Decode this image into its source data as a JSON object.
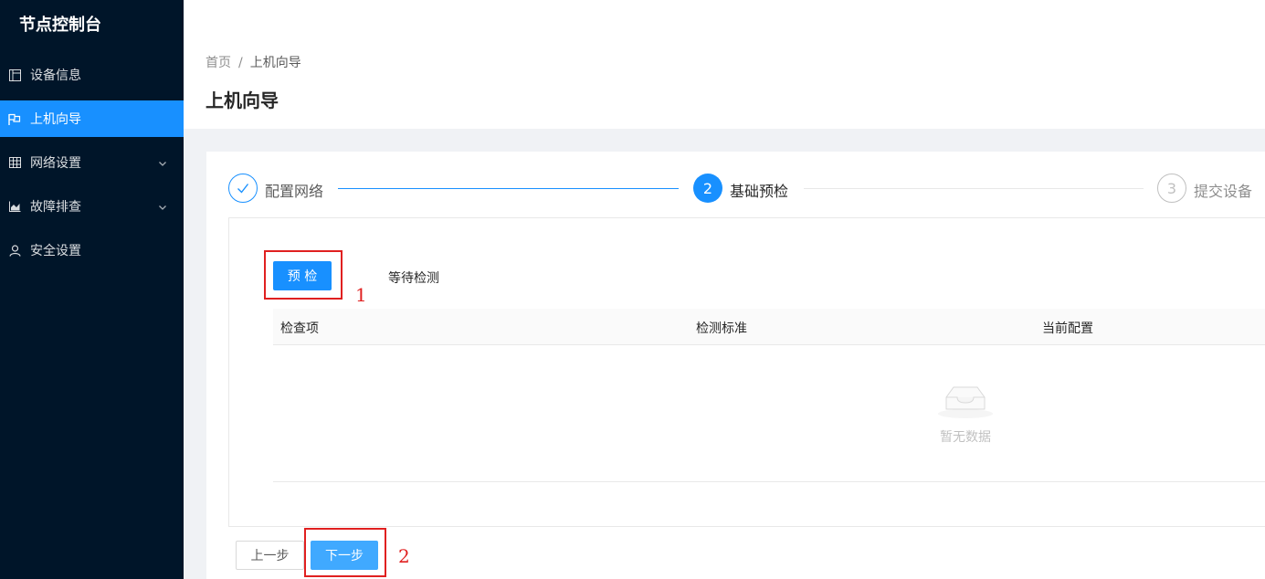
{
  "app": {
    "title": "节点控制台"
  },
  "sidebar": {
    "items": [
      {
        "label": "设备信息",
        "icon": "profile-icon",
        "active": false,
        "has_submenu": false
      },
      {
        "label": "上机向导",
        "icon": "flag-icon",
        "active": true,
        "has_submenu": false
      },
      {
        "label": "网络设置",
        "icon": "table-icon",
        "active": false,
        "has_submenu": true
      },
      {
        "label": "故障排查",
        "icon": "area-chart-icon",
        "active": false,
        "has_submenu": true
      },
      {
        "label": "安全设置",
        "icon": "user-icon",
        "active": false,
        "has_submenu": false
      }
    ]
  },
  "breadcrumb": {
    "home": "首页",
    "separator": "/",
    "current": "上机向导"
  },
  "page": {
    "title": "上机向导"
  },
  "steps": [
    {
      "label": "配置网络",
      "number": "1",
      "status": "finish"
    },
    {
      "label": "基础预检",
      "number": "2",
      "status": "process"
    },
    {
      "label": "提交设备",
      "number": "3",
      "status": "wait"
    }
  ],
  "precheck": {
    "button_label": "预 检",
    "status": "等待检测"
  },
  "table": {
    "columns": [
      "检查项",
      "检测标准",
      "当前配置"
    ],
    "rows": [],
    "empty_text": "暂无数据"
  },
  "footer": {
    "prev_label": "上一步",
    "next_label": "下一步"
  },
  "annotations": [
    "1",
    "2"
  ],
  "colors": {
    "sidebar_bg": "#001529",
    "primary": "#1890ff",
    "annotation": "#e02020"
  }
}
